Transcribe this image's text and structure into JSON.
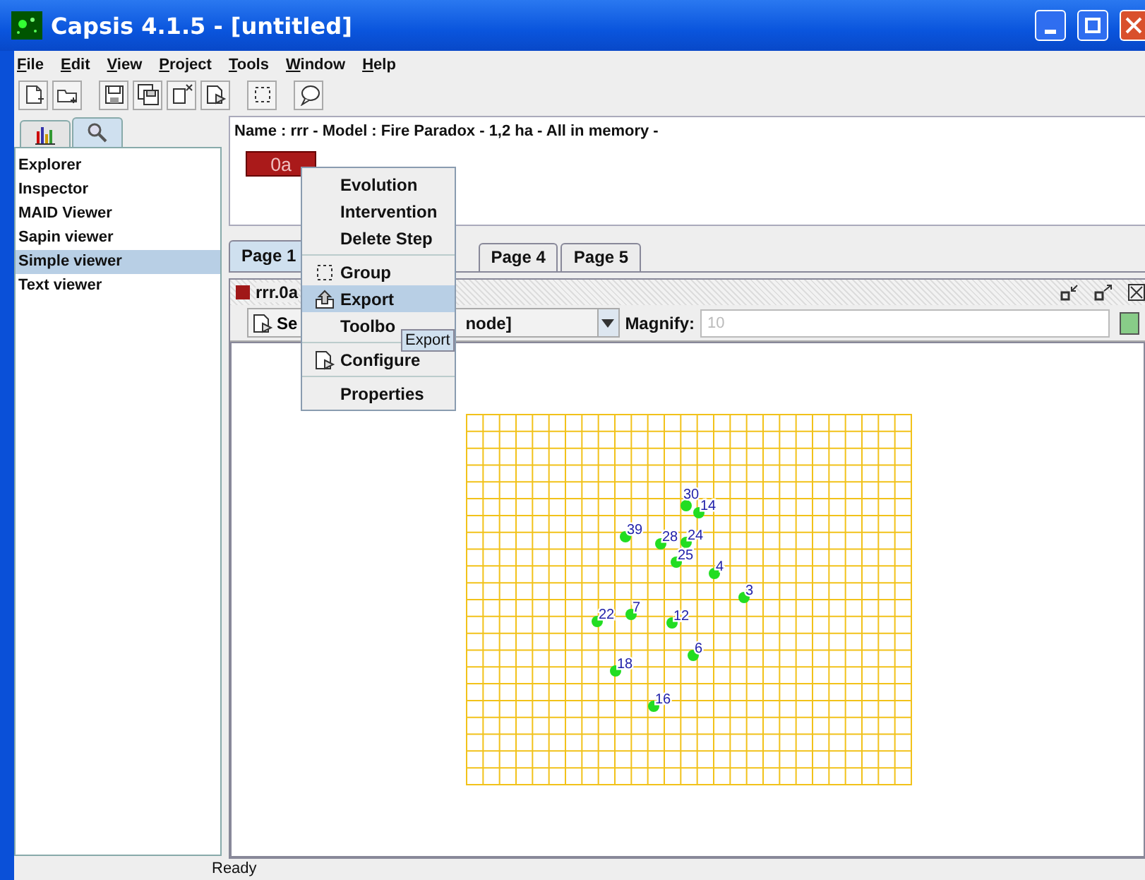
{
  "window": {
    "title": "Capsis 4.1.5 - [untitled]"
  },
  "menu_bar": [
    "File",
    "Edit",
    "View",
    "Project",
    "Tools",
    "Window",
    "Help"
  ],
  "toolbar": [
    {
      "kind": "new-project"
    },
    {
      "kind": "open-project"
    },
    {
      "kind": "separator"
    },
    {
      "kind": "save"
    },
    {
      "kind": "save-as"
    },
    {
      "kind": "close"
    },
    {
      "kind": "configure"
    },
    {
      "kind": "separator"
    },
    {
      "kind": "group"
    },
    {
      "kind": "separator"
    },
    {
      "kind": "comment"
    }
  ],
  "side_tabs": [
    {
      "kind": "chart",
      "selected": false
    },
    {
      "kind": "search",
      "selected": true
    }
  ],
  "side_list": [
    {
      "label": "Explorer",
      "selected": false
    },
    {
      "label": "Inspector",
      "selected": false
    },
    {
      "label": "MAID Viewer",
      "selected": false
    },
    {
      "label": "Sapin viewer",
      "selected": false
    },
    {
      "label": "Simple viewer",
      "selected": true
    },
    {
      "label": "Text viewer",
      "selected": false
    }
  ],
  "project": {
    "info": "Name : rrr - Model : Fire Paradox - 1,2 ha - All in memory -",
    "step": "0a"
  },
  "page_tabs": [
    {
      "label": "Page 1",
      "selected": true
    },
    {
      "label": "Page 4",
      "selected": false
    },
    {
      "label": "Page 5",
      "selected": false
    }
  ],
  "viewer": {
    "title": "rrr.0a",
    "mode_button": "Se",
    "mode_value": "node]",
    "magnify_label": "Magnify:",
    "magnify_value": "10",
    "trees": [
      {
        "label": "30"
      },
      {
        "label": "14"
      },
      {
        "label": "39"
      },
      {
        "label": "28"
      },
      {
        "label": "24"
      },
      {
        "label": "25"
      },
      {
        "label": "4"
      },
      {
        "label": "3"
      },
      {
        "label": "7"
      },
      {
        "label": "22"
      },
      {
        "label": "12"
      },
      {
        "label": "6"
      },
      {
        "label": "18"
      },
      {
        "label": "16"
      }
    ]
  },
  "context_menu": [
    {
      "kind": "item",
      "label": "Evolution",
      "selected": false
    },
    {
      "kind": "item",
      "label": "Intervention",
      "selected": false
    },
    {
      "kind": "item",
      "label": "Delete Step",
      "selected": false
    },
    {
      "kind": "separator"
    },
    {
      "kind": "group",
      "label": "Group",
      "selected": false
    },
    {
      "kind": "export",
      "label": "Export",
      "selected": true
    },
    {
      "kind": "item",
      "label": "Toolbo",
      "selected": false
    },
    {
      "kind": "separator"
    },
    {
      "kind": "configure",
      "label": "Configure",
      "selected": false
    },
    {
      "kind": "separator"
    },
    {
      "kind": "item",
      "label": "Properties",
      "selected": false
    }
  ],
  "tooltip": "Export",
  "status_bar": "Ready"
}
